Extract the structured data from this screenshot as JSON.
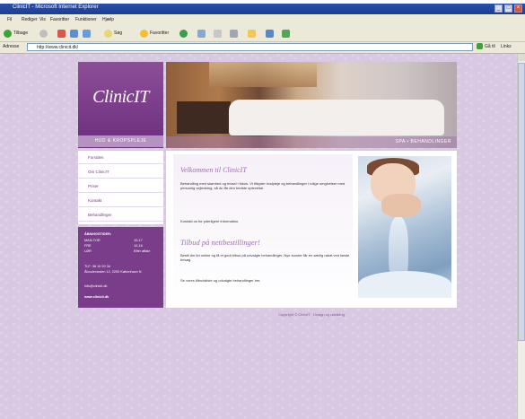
{
  "window": {
    "title": "ClinicIT - Microsoft Internet Explorer"
  },
  "menu": [
    "Fil",
    "Rediger",
    "Vis",
    "Favoritter",
    "Funktioner",
    "Hjælp"
  ],
  "toolbar": {
    "back": "Tilbage",
    "search": "Søg",
    "favorites": "Favoritter"
  },
  "address": {
    "label": "Adresse",
    "url": "http://www.clinicit.dk/",
    "go": "Gå til",
    "links": "Links"
  },
  "site": {
    "logo": "ClinicIT",
    "logo_tagline": "HUD & KROPSPLEJE",
    "banner_tagline": "SPA • BEHANDLINGER",
    "nav": [
      "Forsiden",
      "Om ClinicIT",
      "Priser",
      "Kontakt",
      "Behandlinger"
    ],
    "info": {
      "heading": "ÅBNINGSTIDER:",
      "rows": [
        {
          "label": "MAN-TOR",
          "value": "10-17"
        },
        {
          "label": "FRE",
          "value": "10-16"
        },
        {
          "label": "LØR",
          "value": "Efter aftale"
        }
      ],
      "phone": "TLF: 38 10 29 34",
      "address": "Åboulevarden 12, 2200 København N",
      "email": "info@clinicit.dk",
      "web": "www.clinicit.dk"
    },
    "main": {
      "heading": "Velkommen til ClinicIT",
      "paragraph1": "Behandling med skønhed og trivsel i fokus. Vi tilbyder hudpleje og behandlinger i rolige omgivelser med personlig vejledning, så du får den bedste oplevelse.",
      "paragraph2": "Kontakt os for yderligere information.",
      "subheading": "Tilbud på nettbestillinger!",
      "paragraph3": "Bestil din tid online og få et godt tilbud på udvalgte behandlinger. Nye kunder får en særlig rabat ved første besøg.",
      "paragraph4": "Se vores tilbudsliste og udvalgte behandlinger her."
    },
    "footer": "Copyright © ClinicIT · Design og udvikling"
  }
}
